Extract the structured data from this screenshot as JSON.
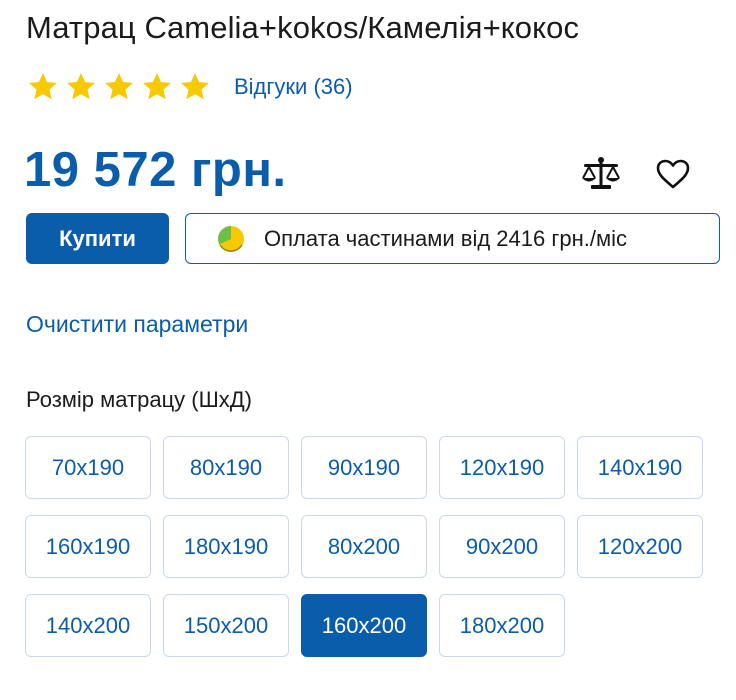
{
  "product": {
    "title": "Матрац Camelia+kokos/Камелія+кокос",
    "rating_stars": 5,
    "reviews_label": "Відгуки (36)",
    "price": "19 572 грн."
  },
  "actions": {
    "buy_label": "Купити",
    "installments_label": "Оплата частинами від 2416 грн./міс",
    "compare_icon": "scales-icon",
    "wishlist_icon": "heart-icon"
  },
  "filters": {
    "clear_label": "Очистити параметри",
    "size_label": "Розмір матрацу (ШхД)",
    "selected": "160x200",
    "sizes": [
      "70x190",
      "80x190",
      "90x190",
      "120x190",
      "140x190",
      "160x190",
      "180x190",
      "80x200",
      "90x200",
      "120x200",
      "140x200",
      "150x200",
      "160x200",
      "180x200"
    ]
  },
  "colors": {
    "accent": "#0a5dab",
    "star": "#f6c900",
    "option_border": "#c9d9ea"
  }
}
